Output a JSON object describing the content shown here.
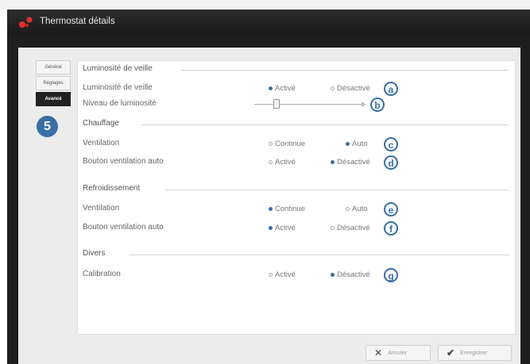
{
  "window": {
    "title": "Thermostat détails"
  },
  "tabs": [
    {
      "label": "Général",
      "active": false
    },
    {
      "label": "Réglages",
      "active": false
    },
    {
      "label": "Avancé",
      "active": true
    }
  ],
  "step_badge": "5",
  "sections": {
    "luminosite": {
      "title": "Luminosité de veille",
      "rows": {
        "luminosite_veille": {
          "label": "Luminosité de veille",
          "opt1": "Activé",
          "opt2": "Désactivé",
          "selected": 1,
          "marker": "a"
        },
        "niveau": {
          "label": "Niveau de luminosité",
          "level_fraction": 0.2,
          "marker": "b"
        }
      }
    },
    "chauffage": {
      "title": "Chauffage",
      "rows": {
        "ventilation": {
          "label": "Ventilation",
          "opt1": "Continue",
          "opt2": "Auto",
          "selected": 2,
          "marker": "c"
        },
        "bouton_auto": {
          "label": "Bouton ventilation auto",
          "opt1": "Activé",
          "opt2": "Désactivé",
          "selected": 2,
          "marker": "d"
        }
      }
    },
    "refroidissement": {
      "title": "Refroidissement",
      "rows": {
        "ventilation": {
          "label": "Ventilation",
          "opt1": "Continue",
          "opt2": "Auto",
          "selected": 1,
          "marker": "e"
        },
        "bouton_auto": {
          "label": "Bouton ventilation auto",
          "opt1": "Activé",
          "opt2": "Désactivé",
          "selected": 1,
          "marker": "f"
        }
      }
    },
    "divers": {
      "title": "Divers",
      "rows": {
        "calibration": {
          "label": "Calibration",
          "opt1": "Activé",
          "opt2": "Désactivé",
          "selected": 2,
          "marker": "g"
        }
      }
    }
  },
  "footer": {
    "cancel_label": "Annuler",
    "save_label": "Enregistrer"
  },
  "colors": {
    "accent": "#3a6ea5",
    "titlebar": "#222222",
    "brand_icon": "#e0302a"
  }
}
